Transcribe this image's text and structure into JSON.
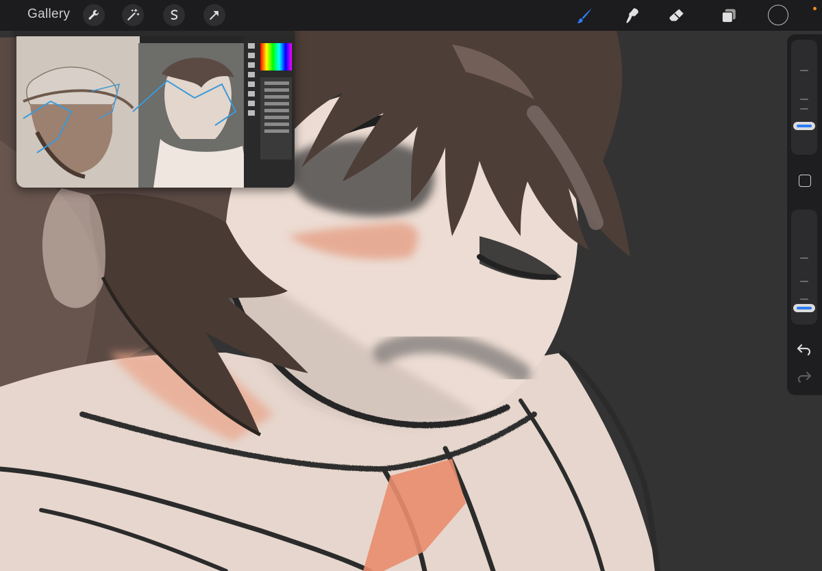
{
  "topbar": {
    "gallery_label": "Gallery",
    "left_tools": [
      {
        "name": "actions",
        "icon": "wrench-icon"
      },
      {
        "name": "adjustments",
        "icon": "magic-wand-icon"
      },
      {
        "name": "selection",
        "icon": "selection-s-icon"
      },
      {
        "name": "transform",
        "icon": "arrow-icon"
      }
    ],
    "right_tools": [
      {
        "name": "brush",
        "icon": "brush-icon",
        "active": true
      },
      {
        "name": "smudge",
        "icon": "smudge-icon"
      },
      {
        "name": "eraser",
        "icon": "eraser-icon"
      },
      {
        "name": "layers",
        "icon": "layers-icon"
      }
    ],
    "color_well": {
      "icon": "color-circle-icon",
      "color": "#1c1c1e"
    }
  },
  "sidebar": {
    "brush_size_level": 0.85,
    "opacity_level": 0.9,
    "modifier_icon": "square-modifier-icon",
    "undo_icon": "undo-icon",
    "redo_icon": "redo-icon"
  },
  "reference_window": {
    "app": "photoshop-reference-overlay",
    "panels": [
      "colour-picker",
      "layers-panel"
    ]
  },
  "colors": {
    "accent": "#2d7cf6",
    "toolbar_bg": "#1c1c1e",
    "canvas_bg": "#333333",
    "skin": "#e9d9d0",
    "hair": "#4a3a34",
    "blush": "#e8a38a",
    "line": "#2b2b2b"
  }
}
